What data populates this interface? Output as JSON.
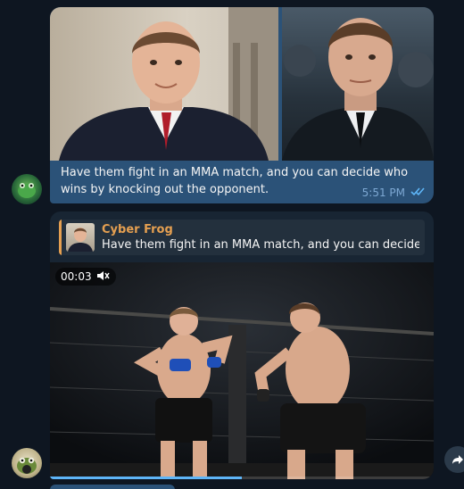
{
  "message_outgoing": {
    "caption": "Have them fight in an MMA match, and you can decide who wins by knocking out the opponent.",
    "time": "5:51 PM",
    "status_icon": "double-check-icon"
  },
  "message_reply": {
    "reply": {
      "name": "Cyber Frog",
      "text": "Have them fight in an MMA match, and you can decide wh..."
    },
    "video": {
      "timestamp": "00:03",
      "sound_icon": "muted-speaker-icon",
      "progress": 0.5
    }
  },
  "colors": {
    "background": "#0e1621",
    "outgoing_bubble": "#2b5278",
    "incoming_bubble": "#182533",
    "reply_accent": "#e6a051",
    "meta_text": "#7da8d3"
  },
  "icons": {
    "share": "share-arrow-icon"
  }
}
